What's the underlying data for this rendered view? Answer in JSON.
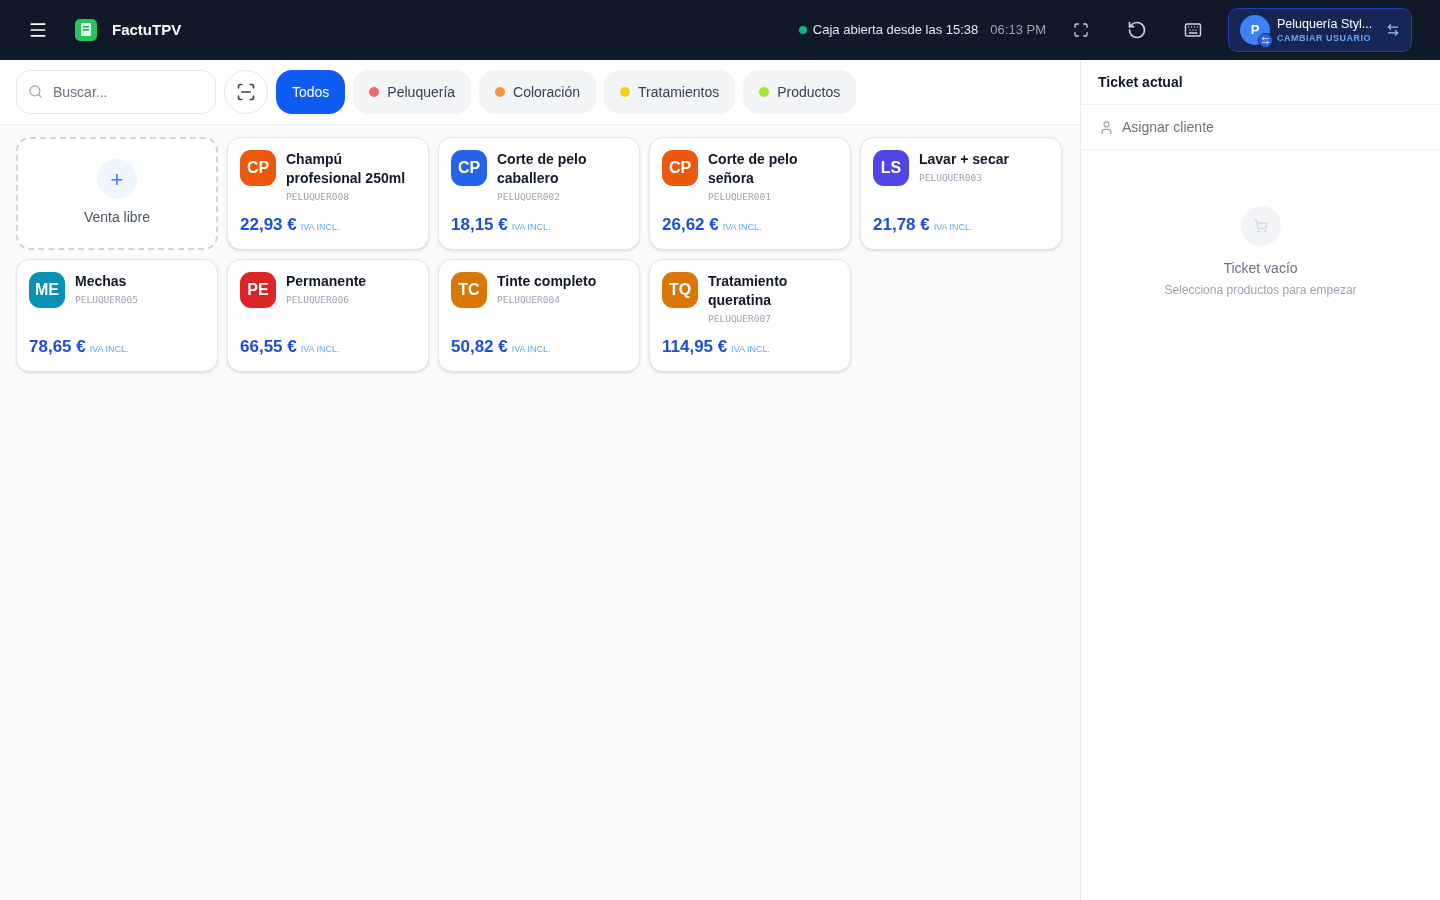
{
  "topbar": {
    "app_name": "FactuTPV",
    "status": "Caja abierta desde las 15:38",
    "time": "06:13 PM",
    "user": {
      "initial": "P",
      "name": "Peluquería Styl...",
      "action": "CAMBIAR USUARIO"
    }
  },
  "search": {
    "placeholder": "Buscar..."
  },
  "categories": [
    {
      "label": "Todos",
      "selected": true
    },
    {
      "label": "Peluquería",
      "selected": false,
      "color": "#f06a6a"
    },
    {
      "label": "Coloración",
      "selected": false,
      "color": "#fb923c"
    },
    {
      "label": "Tratamientos",
      "selected": false,
      "color": "#facc15"
    },
    {
      "label": "Productos",
      "selected": false,
      "color": "#a3e635"
    }
  ],
  "free_sale": {
    "label": "Venta libre",
    "icon": "+"
  },
  "products": [
    {
      "initials": "CP",
      "color": "#ea580c",
      "name": "Champú profesional 250ml",
      "code": "PELUQUER008",
      "price": "22,93 €",
      "tax": "IVA INCL."
    },
    {
      "initials": "CP",
      "color": "#2563eb",
      "name": "Corte de pelo caballero",
      "code": "PELUQUER002",
      "price": "18,15 €",
      "tax": "IVA INCL."
    },
    {
      "initials": "CP",
      "color": "#ea580c",
      "name": "Corte de pelo señora",
      "code": "PELUQUER001",
      "price": "26,62 €",
      "tax": "IVA INCL."
    },
    {
      "initials": "LS",
      "color": "#4f46e5",
      "name": "Lavar + secar",
      "code": "PELUQUER003",
      "price": "21,78 €",
      "tax": "IVA INCL."
    },
    {
      "initials": "ME",
      "color": "#0891b2",
      "name": "Mechas",
      "code": "PELUQUER005",
      "price": "78,65 €",
      "tax": "IVA INCL."
    },
    {
      "initials": "PE",
      "color": "#dc2626",
      "name": "Permanente",
      "code": "PELUQUER006",
      "price": "66,55 €",
      "tax": "IVA INCL."
    },
    {
      "initials": "TC",
      "color": "#d97706",
      "name": "Tinte completo",
      "code": "PELUQUER004",
      "price": "50,82 €",
      "tax": "IVA INCL."
    },
    {
      "initials": "TQ",
      "color": "#d97706",
      "name": "Tratamiento queratina",
      "code": "PELUQUER007",
      "price": "114,95 €",
      "tax": "IVA INCL."
    }
  ],
  "ticket": {
    "title": "Ticket actual",
    "assign_client": "Asignar cliente",
    "empty_title": "Ticket vacío",
    "empty_hint": "Selecciona productos para empezar"
  }
}
